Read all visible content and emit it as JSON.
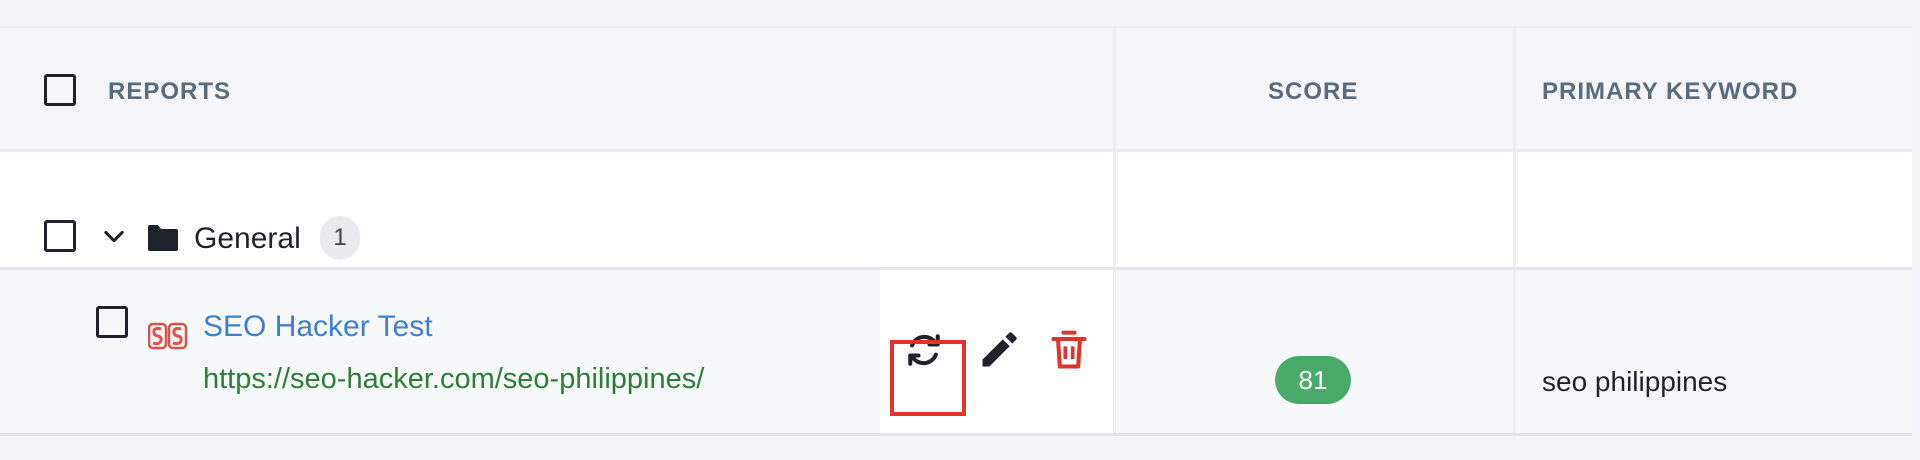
{
  "table": {
    "columns": {
      "reports": "REPORTS",
      "score": "SCORE",
      "primary_keyword": "PRIMARY KEYWORD"
    },
    "groups": [
      {
        "name": "General",
        "count": "1",
        "icon": "folder-icon",
        "expanded": true,
        "reports": [
          {
            "title": "SEO Hacker Test",
            "url": "https://seo-hacker.com/seo-philippines/",
            "score": "81",
            "primary_keyword": "seo philippines",
            "favicon": "seo-hacker-logo-icon",
            "actions": [
              "refresh-icon",
              "edit-icon",
              "delete-icon"
            ],
            "highlighted_action": "refresh-icon"
          }
        ]
      }
    ]
  },
  "colors": {
    "link": "#3f7fd1",
    "url": "#2f7d3a",
    "score_badge": "#4aaa6b",
    "delete": "#e0332b",
    "highlight": "#e0332b"
  }
}
